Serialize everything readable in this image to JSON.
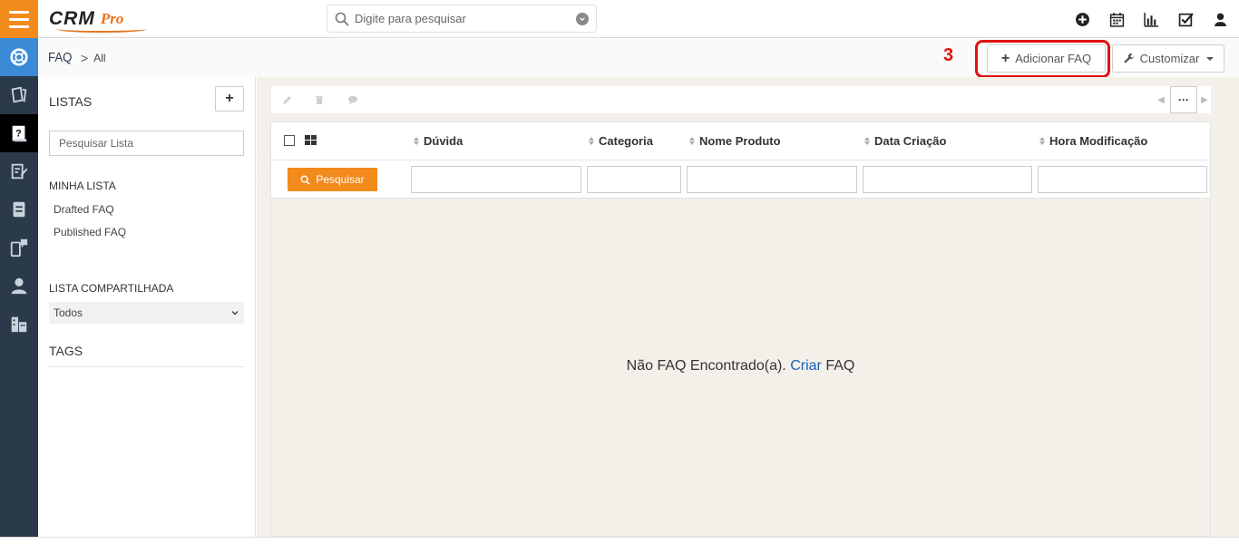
{
  "app": {
    "logo_main": "CRM",
    "logo_sub": "Pro"
  },
  "search": {
    "placeholder": "Digite para pesquisar"
  },
  "breadcrumb": {
    "module": "FAQ",
    "separator": ">",
    "current": "All"
  },
  "annotation": {
    "step_number": "3"
  },
  "actions": {
    "add_label": "Adicionar FAQ",
    "customize_label": "Customizar"
  },
  "lists_panel": {
    "title": "LISTAS",
    "search_placeholder": "Pesquisar Lista",
    "my_list_title": "MINHA LISTA",
    "my_lists": [
      "Drafted FAQ",
      "Published FAQ"
    ],
    "shared_title": "LISTA COMPARTILHADA",
    "shared_selected": "Todos",
    "tags_title": "TAGS"
  },
  "table": {
    "columns": [
      "Dúvida",
      "Categoria",
      "Nome Produto",
      "Data Criação",
      "Hora Modificação"
    ],
    "search_button": "Pesquisar",
    "empty_prefix": "Não FAQ Encontrado(a).",
    "empty_link": "Criar",
    "empty_suffix": "FAQ"
  },
  "pager": {
    "more_label": "···"
  },
  "colors": {
    "accent": "#f28a1c",
    "rail": "#2b3a4a",
    "highlight": "#e01212",
    "link": "#1a5fb4"
  }
}
